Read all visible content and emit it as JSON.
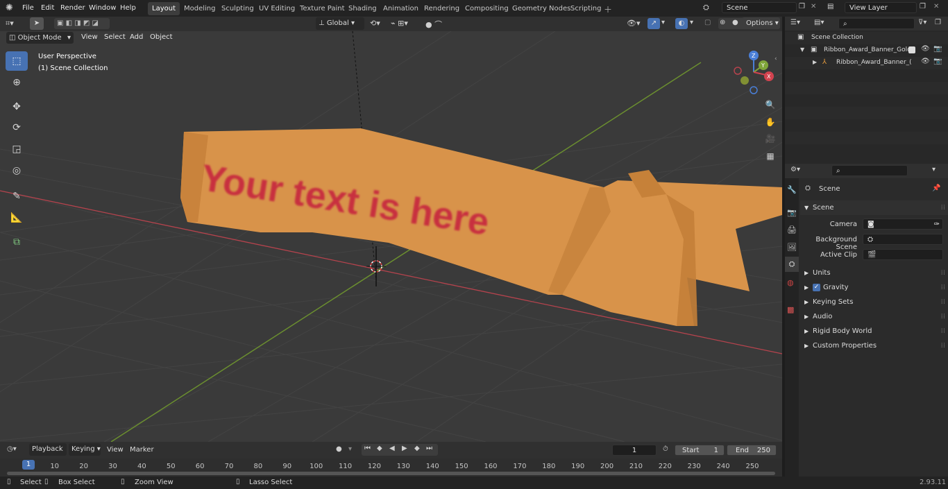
{
  "menus": [
    "File",
    "Edit",
    "Render",
    "Window",
    "Help"
  ],
  "workspaces": [
    "Layout",
    "Modeling",
    "Sculpting",
    "UV Editing",
    "Texture Paint",
    "Shading",
    "Animation",
    "Rendering",
    "Compositing",
    "Geometry Nodes",
    "Scripting"
  ],
  "scene_name": "Scene",
  "view_layer": "View Layer",
  "viewport": {
    "mode": "Object Mode",
    "menu": [
      "View",
      "Select",
      "Add",
      "Object"
    ],
    "transform": "Global",
    "options": "Options",
    "overlay_title": "User Perspective",
    "overlay_sub": "(1) Scene Collection",
    "banner_text": "Your text is here"
  },
  "gizmo": {
    "z": "Z",
    "y": "Y",
    "x": "X"
  },
  "outliner": {
    "root": "Scene Collection",
    "items": [
      "Ribbon_Award_Banner_Gold_",
      "Ribbon_Award_Banner_("
    ]
  },
  "properties": {
    "tab": "Scene",
    "section": "Scene",
    "camera_label": "Camera",
    "bg_label": "Background Scene",
    "clip_label": "Active Clip",
    "panels": [
      "Units",
      "Gravity",
      "Keying Sets",
      "Audio",
      "Rigid Body World",
      "Custom Properties"
    ]
  },
  "timeline": {
    "menus": [
      "Playback",
      "Keying",
      "View",
      "Marker"
    ],
    "current": "1",
    "start_label": "Start",
    "start": "1",
    "end_label": "End",
    "end": "250",
    "ticks": [
      "1",
      "10",
      "20",
      "30",
      "40",
      "50",
      "60",
      "70",
      "80",
      "90",
      "100",
      "110",
      "120",
      "130",
      "140",
      "150",
      "160",
      "170",
      "180",
      "190",
      "200",
      "210",
      "220",
      "230",
      "240",
      "250"
    ]
  },
  "status": {
    "select": "Select",
    "box": "Box Select",
    "zoom": "Zoom View",
    "lasso": "Lasso Select",
    "version": "2.93.11"
  },
  "colors": {
    "accent": "#4772b3",
    "banner": "#d8934a",
    "text": "#c8303f",
    "x_axis": "#d2434f",
    "y_axis": "#7fa53a"
  }
}
